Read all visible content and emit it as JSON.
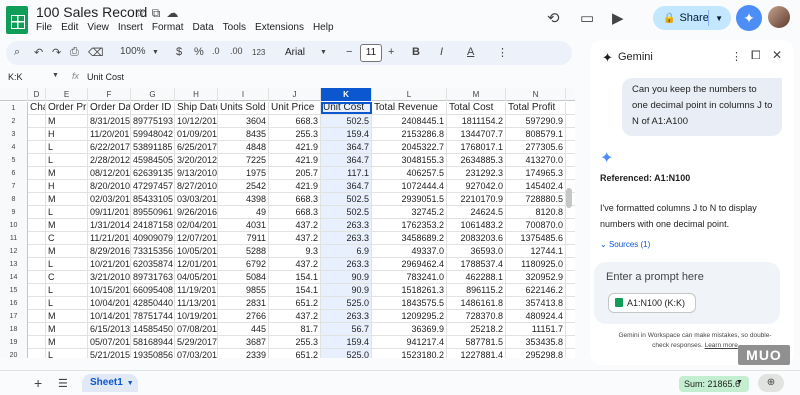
{
  "header": {
    "title": "100 Sales Record",
    "menu": [
      "File",
      "Edit",
      "View",
      "Insert",
      "Format",
      "Data",
      "Tools",
      "Extensions",
      "Help"
    ],
    "share_label": "Share"
  },
  "toolbar": {
    "zoom": "100%",
    "currency": "$",
    "percent": "%",
    "dec_less": ".0",
    "dec_more": ".00",
    "number_format": "123",
    "font": "Arial",
    "font_size": "11",
    "bold": "B",
    "text_color": "A"
  },
  "formula_bar": {
    "name_box": "K:K",
    "fx": "fx",
    "value": "Unit Cost"
  },
  "grid": {
    "columns": [
      "D",
      "E",
      "F",
      "G",
      "H",
      "I",
      "J",
      "K",
      "L",
      "M",
      "N"
    ],
    "selected_column": "K",
    "headers": [
      "Cha",
      "Order Prio",
      "Order Dat",
      "Order ID",
      "Ship Date",
      "Units Sold",
      "Unit Price",
      "Unit Cost",
      "Total Revenue",
      "Total Cost",
      "Total Profit"
    ],
    "rows": [
      [
        "1",
        "",
        "",
        "",
        "",
        "",
        "",
        "",
        "",
        "",
        "",
        ""
      ],
      [
        "2",
        "",
        "M",
        "8/31/2015",
        "89775193",
        "10/12/201",
        "3604",
        "668.3",
        "502.5",
        "2408445.1",
        "1811154.2",
        "597290.9"
      ],
      [
        "3",
        "",
        "H",
        "11/20/201",
        "59948042",
        "01/09/201",
        "8435",
        "255.3",
        "159.4",
        "2153286.8",
        "1344707.7",
        "808579.1"
      ],
      [
        "4",
        "",
        "L",
        "6/22/2017",
        "53891185",
        "6/25/2017",
        "4848",
        "421.9",
        "364.7",
        "2045322.7",
        "1768017.1",
        "277305.6"
      ],
      [
        "5",
        "",
        "L",
        "2/28/2012",
        "45984505",
        "3/20/2012",
        "7225",
        "421.9",
        "364.7",
        "3048155.3",
        "2634885.3",
        "413270.0"
      ],
      [
        "6",
        "",
        "M",
        "08/12/201",
        "62639135",
        "9/13/2010",
        "1975",
        "205.7",
        "117.1",
        "406257.5",
        "231292.3",
        "174965.3"
      ],
      [
        "7",
        "",
        "H",
        "8/20/2010",
        "47297457",
        "8/27/2010",
        "2542",
        "421.9",
        "364.7",
        "1072444.4",
        "927042.0",
        "145402.4"
      ],
      [
        "8",
        "",
        "M",
        "02/03/201",
        "85433105",
        "03/03/201",
        "4398",
        "668.3",
        "502.5",
        "2939051.5",
        "2210170.9",
        "728880.5"
      ],
      [
        "9",
        "",
        "L",
        "09/11/201",
        "89550961",
        "9/26/2016",
        "49",
        "668.3",
        "502.5",
        "32745.2",
        "24624.5",
        "8120.8"
      ],
      [
        "10",
        "",
        "M",
        "1/31/2014",
        "24187158",
        "02/04/201",
        "4031",
        "437.2",
        "263.3",
        "1762353.2",
        "1061483.2",
        "700870.0"
      ],
      [
        "11",
        "",
        "C",
        "11/21/201",
        "40909079",
        "12/07/201",
        "7911",
        "437.2",
        "263.3",
        "3458689.2",
        "2083203.6",
        "1375485.6"
      ],
      [
        "12",
        "",
        "M",
        "8/29/2016",
        "73315356",
        "10/05/201",
        "5288",
        "9.3",
        "6.9",
        "49337.0",
        "36593.0",
        "12744.1"
      ],
      [
        "13",
        "",
        "L",
        "10/21/201",
        "62035874",
        "12/01/201",
        "6792",
        "437.2",
        "263.3",
        "2969462.4",
        "1788537.4",
        "1180925.0"
      ],
      [
        "14",
        "",
        "C",
        "3/21/2010",
        "89731763",
        "04/05/201",
        "5084",
        "154.1",
        "90.9",
        "783241.0",
        "462288.1",
        "320952.9"
      ],
      [
        "15",
        "",
        "L",
        "10/15/201",
        "66095408",
        "11/19/201",
        "9855",
        "154.1",
        "90.9",
        "1518261.3",
        "896115.2",
        "622146.2"
      ],
      [
        "16",
        "",
        "L",
        "10/04/201",
        "42850440",
        "11/13/201",
        "2831",
        "651.2",
        "525.0",
        "1843575.5",
        "1486161.8",
        "357413.8"
      ],
      [
        "17",
        "",
        "M",
        "10/14/201",
        "78751744",
        "10/19/201",
        "2766",
        "437.2",
        "263.3",
        "1209295.2",
        "728370.8",
        "480924.4"
      ],
      [
        "18",
        "",
        "M",
        "6/15/2013",
        "14585450",
        "07/08/201",
        "445",
        "81.7",
        "56.7",
        "36369.9",
        "25218.2",
        "11151.7"
      ],
      [
        "19",
        "",
        "M",
        "05/07/201",
        "58168944",
        "5/29/2017",
        "3687",
        "255.3",
        "159.4",
        "941217.4",
        "587781.5",
        "353435.8"
      ],
      [
        "20",
        "",
        "L",
        "5/21/2015",
        "19350856",
        "07/03/201",
        "2339",
        "651.2",
        "525.0",
        "1523180.2",
        "1227881.4",
        "295298.8"
      ],
      [
        "21",
        "",
        "H",
        "6/28/2016",
        "75011070",
        "7/14/2016",
        "3283",
        "47.5",
        "31.8",
        "155778.4",
        "104366.6",
        "51411.8"
      ],
      [
        "22",
        "",
        "C",
        "07/08/201",
        "84690720",
        "04/29/201",
        "2",
        "47.5",
        "31.8",
        "94.1",
        "63.7",
        "31.9"
      ]
    ]
  },
  "bottom": {
    "sheet_name": "Sheet1",
    "sum": "Sum: 21865.6"
  },
  "gemini": {
    "title": "Gemini",
    "user_message": "Can you keep the numbers to one decimal point in columns J to N of A1:A100",
    "referenced": "Referenced: A1:N100",
    "response": "I've formatted columns J to N to display numbers with one decimal point.",
    "sources": "Sources (1)",
    "prompt_placeholder": "Enter a prompt here",
    "chip": "A1:N100 (K:K)",
    "disclaimer": "Gemini in Workspace can make mistakes, so double-check responses.",
    "learn_more": "Learn more"
  },
  "watermark": "MUO",
  "colors": {
    "accent": "#0b57d0",
    "share_bg": "#c2e7ff",
    "selected_col": "#e8f0fe",
    "sheets_green": "#0f9d58",
    "sum_bg": "#c4eed0"
  },
  "icons": [
    "star-icon",
    "move-icon",
    "cloud-icon",
    "history-icon",
    "comment-icon",
    "video-icon",
    "lock-icon",
    "gemini-icon",
    "undo-icon",
    "redo-icon",
    "print-icon",
    "paint-format-icon",
    "more-vert-icon",
    "dock-icon",
    "close-icon",
    "plus-icon",
    "list-icon",
    "explore-icon",
    "sheets-chip-icon"
  ]
}
